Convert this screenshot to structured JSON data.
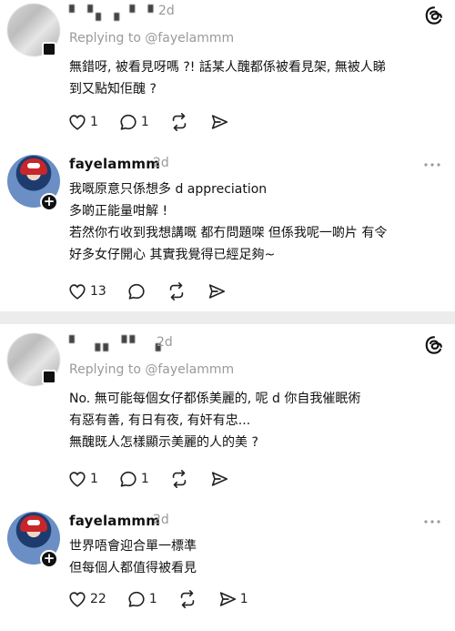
{
  "thread1": {
    "reply": {
      "username": "▘▝▖▗ ▘▝",
      "time": "2d",
      "replying_to": "Replying to @fayelammm",
      "lines": [
        "無錯呀, 被看見呀嗎 ?! 話某人醜都係被看見架, 無被人睇",
        "到又點知佢醜 ?"
      ],
      "likes": "1",
      "comments": "1",
      "reposts": "",
      "shares": ""
    },
    "author": {
      "username": "fayelammm",
      "time": "2d",
      "lines": [
        "我嘅原意只係想多 d appreciation",
        "多啲正能量咁解 !",
        "若然你冇收到我想講嘅 都冇問題㗎 但係我呢一啲片 有令",
        "好多女仔開心 其實我覺得已經足夠~"
      ],
      "likes": "13",
      "comments": "",
      "reposts": "",
      "shares": ""
    }
  },
  "thread2": {
    "reply": {
      "username": "▘ ▗▖▝▘ ▗",
      "time": "2d",
      "replying_to": "Replying to @fayelammm",
      "lines": [
        "No. 無可能每個女仔都係美麗的, 呢 d 你自我催眠術",
        "有惡有善, 有日有夜, 有奸有忠...",
        "無醜既人怎樣顯示美麗的人的美 ?"
      ],
      "likes": "1",
      "comments": "1",
      "reposts": "",
      "shares": ""
    },
    "author": {
      "username": "fayelammm",
      "time": "2d",
      "lines": [
        "世界唔會迎合單一標準",
        "但每個人都值得被看見"
      ],
      "likes": "22",
      "comments": "1",
      "reposts": "",
      "shares": "1"
    }
  },
  "icons": {
    "threads_logo": "threads-logo-icon",
    "more": "more-icon",
    "like": "heart-icon",
    "comment": "comment-icon",
    "repost": "repost-icon",
    "share": "share-icon"
  },
  "colors": {
    "text": "#111111",
    "muted": "#9a9a9a",
    "divider": "#ececec"
  }
}
